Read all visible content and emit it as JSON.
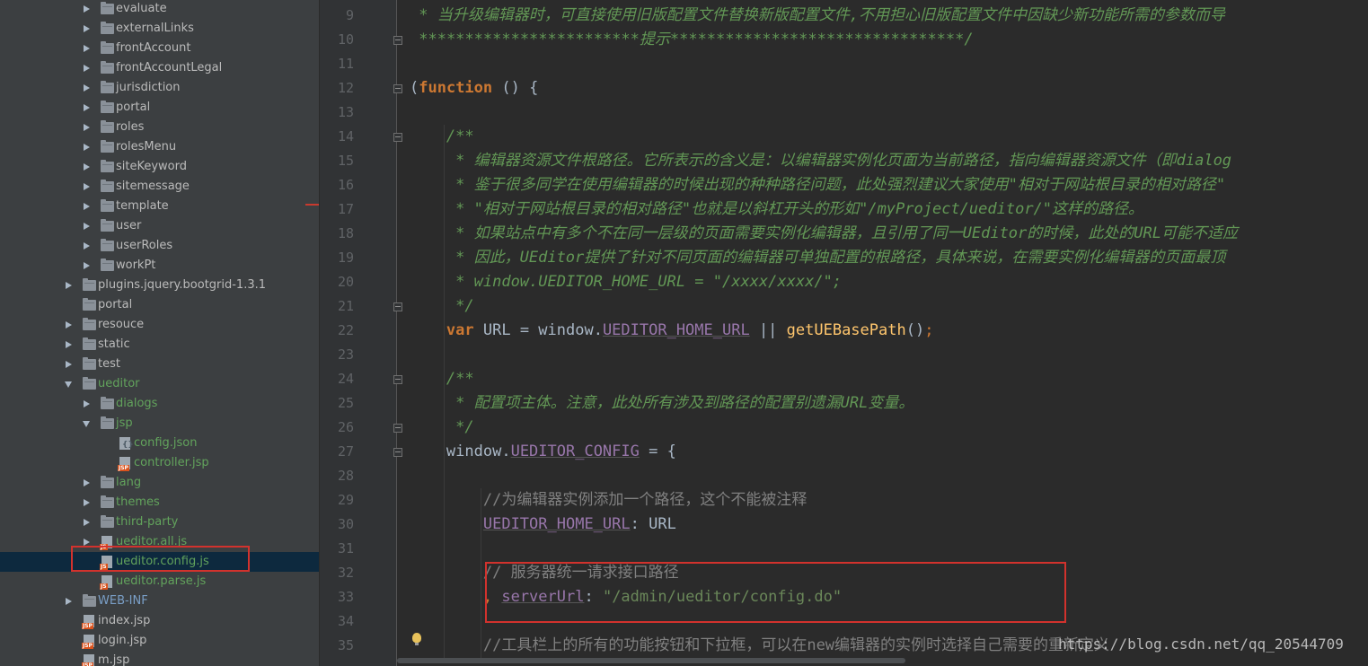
{
  "tree": {
    "nodes": [
      {
        "label": "evaluate",
        "indent": 1,
        "type": "folder",
        "state": "collapsed",
        "color": "default"
      },
      {
        "label": "externalLinks",
        "indent": 1,
        "type": "folder",
        "state": "collapsed",
        "color": "default"
      },
      {
        "label": "frontAccount",
        "indent": 1,
        "type": "folder",
        "state": "collapsed",
        "color": "default"
      },
      {
        "label": "frontAccountLegal",
        "indent": 1,
        "type": "folder",
        "state": "collapsed",
        "color": "default"
      },
      {
        "label": "jurisdiction",
        "indent": 1,
        "type": "folder",
        "state": "collapsed",
        "color": "default"
      },
      {
        "label": "portal",
        "indent": 1,
        "type": "folder",
        "state": "collapsed",
        "color": "default"
      },
      {
        "label": "roles",
        "indent": 1,
        "type": "folder",
        "state": "collapsed",
        "color": "default"
      },
      {
        "label": "rolesMenu",
        "indent": 1,
        "type": "folder",
        "state": "collapsed",
        "color": "default"
      },
      {
        "label": "siteKeyword",
        "indent": 1,
        "type": "folder",
        "state": "collapsed",
        "color": "default"
      },
      {
        "label": "sitemessage",
        "indent": 1,
        "type": "folder",
        "state": "collapsed",
        "color": "default"
      },
      {
        "label": "template",
        "indent": 1,
        "type": "folder",
        "state": "collapsed",
        "color": "default"
      },
      {
        "label": "user",
        "indent": 1,
        "type": "folder",
        "state": "collapsed",
        "color": "default"
      },
      {
        "label": "userRoles",
        "indent": 1,
        "type": "folder",
        "state": "collapsed",
        "color": "default"
      },
      {
        "label": "workPt",
        "indent": 1,
        "type": "folder",
        "state": "collapsed",
        "color": "default"
      },
      {
        "label": "plugins.jquery.bootgrid-1.3.1",
        "indent": 0,
        "type": "folder",
        "state": "collapsed",
        "color": "default"
      },
      {
        "label": "portal",
        "indent": 0,
        "type": "folder",
        "state": "none",
        "color": "default"
      },
      {
        "label": "resouce",
        "indent": 0,
        "type": "folder",
        "state": "collapsed",
        "color": "default"
      },
      {
        "label": "static",
        "indent": 0,
        "type": "folder",
        "state": "collapsed",
        "color": "default"
      },
      {
        "label": "test",
        "indent": 0,
        "type": "folder",
        "state": "collapsed",
        "color": "default"
      },
      {
        "label": "ueditor",
        "indent": 0,
        "type": "folder",
        "state": "expanded",
        "color": "green"
      },
      {
        "label": "dialogs",
        "indent": 1,
        "type": "folder",
        "state": "collapsed",
        "color": "green"
      },
      {
        "label": "jsp",
        "indent": 1,
        "type": "folder",
        "state": "expanded",
        "color": "green"
      },
      {
        "label": "config.json",
        "indent": 2,
        "type": "file",
        "tag": "{}",
        "state": "none",
        "color": "green"
      },
      {
        "label": "controller.jsp",
        "indent": 2,
        "type": "file",
        "tag": "JSP",
        "state": "none",
        "color": "green"
      },
      {
        "label": "lang",
        "indent": 1,
        "type": "folder",
        "state": "collapsed",
        "color": "green"
      },
      {
        "label": "themes",
        "indent": 1,
        "type": "folder",
        "state": "collapsed",
        "color": "green"
      },
      {
        "label": "third-party",
        "indent": 1,
        "type": "folder",
        "state": "collapsed",
        "color": "green"
      },
      {
        "label": "ueditor.all.js",
        "indent": 1,
        "type": "file",
        "tag": "JS",
        "state": "collapsed",
        "color": "green"
      },
      {
        "label": "ueditor.config.js",
        "indent": 1,
        "type": "file",
        "tag": "JS",
        "state": "none",
        "color": "green",
        "selected": true
      },
      {
        "label": "ueditor.parse.js",
        "indent": 1,
        "type": "file",
        "tag": "JS",
        "state": "none",
        "color": "green"
      },
      {
        "label": "WEB-INF",
        "indent": 0,
        "type": "folder",
        "state": "collapsed",
        "color": "blue"
      },
      {
        "label": "index.jsp",
        "indent": 0,
        "type": "file",
        "tag": "JSP",
        "state": "none",
        "color": "default"
      },
      {
        "label": "login.jsp",
        "indent": 0,
        "type": "file",
        "tag": "JSP",
        "state": "none",
        "color": "default"
      },
      {
        "label": "m.jsp",
        "indent": 0,
        "type": "file",
        "tag": "JSP",
        "state": "none",
        "color": "default"
      }
    ]
  },
  "editor": {
    "lines": [
      {
        "n": "9",
        "indent": 0,
        "fold": false,
        "tokens": [
          {
            "t": " * 当升级编辑器时，可直接使用旧版配置文件替换新版配置文件,不用担心旧版配置文件中因缺少新功能所需的参数而导",
            "c": "cm"
          }
        ]
      },
      {
        "n": "10",
        "indent": 0,
        "fold": true,
        "tokens": [
          {
            "t": " ************************提示********************************/",
            "c": "cm"
          }
        ]
      },
      {
        "n": "11",
        "indent": 0,
        "fold": false,
        "tokens": []
      },
      {
        "n": "12",
        "indent": 0,
        "fold": true,
        "tokens": [
          {
            "t": "(",
            "c": "tx"
          },
          {
            "t": "function",
            "c": "kw"
          },
          {
            "t": " () {",
            "c": "tx"
          }
        ]
      },
      {
        "n": "13",
        "indent": 0,
        "fold": false,
        "tokens": []
      },
      {
        "n": "14",
        "indent": 4,
        "fold": true,
        "tokens": [
          {
            "t": "/**",
            "c": "cm"
          }
        ]
      },
      {
        "n": "15",
        "indent": 4,
        "fold": false,
        "tokens": [
          {
            "t": " * 编辑器资源文件根路径。它所表示的含义是：以编辑器实例化页面为当前路径，指向编辑器资源文件（即dialog",
            "c": "cm"
          }
        ]
      },
      {
        "n": "16",
        "indent": 4,
        "fold": false,
        "tokens": [
          {
            "t": " * 鉴于很多同学在使用编辑器的时候出现的种种路径问题，此处强烈建议大家使用\"相对于网站根目录的相对路径\"",
            "c": "cm"
          }
        ]
      },
      {
        "n": "17",
        "indent": 4,
        "fold": false,
        "tokens": [
          {
            "t": " * \"相对于网站根目录的相对路径\"也就是以斜杠开头的形如\"/myProject/ueditor/\"这样的路径。",
            "c": "cm"
          }
        ]
      },
      {
        "n": "18",
        "indent": 4,
        "fold": false,
        "tokens": [
          {
            "t": " * 如果站点中有多个不在同一层级的页面需要实例化编辑器，且引用了同一UEditor的时候，此处的URL可能不适应",
            "c": "cm"
          }
        ]
      },
      {
        "n": "19",
        "indent": 4,
        "fold": false,
        "tokens": [
          {
            "t": " * 因此，UEditor提供了针对不同页面的编辑器可单独配置的根路径，具体来说，在需要实例化编辑器的页面最顶",
            "c": "cm"
          }
        ]
      },
      {
        "n": "20",
        "indent": 4,
        "fold": false,
        "tokens": [
          {
            "t": " * window.UEDITOR_HOME_URL = \"/xxxx/xxxx/\";",
            "c": "cm"
          }
        ]
      },
      {
        "n": "21",
        "indent": 4,
        "fold": true,
        "tokens": [
          {
            "t": " */",
            "c": "cm"
          }
        ]
      },
      {
        "n": "22",
        "indent": 4,
        "fold": false,
        "tokens": [
          {
            "t": "var",
            "c": "kw"
          },
          {
            "t": " URL = window.",
            "c": "tx"
          },
          {
            "t": "UEDITOR_HOME_URL",
            "c": "pp"
          },
          {
            "t": " || ",
            "c": "tx"
          },
          {
            "t": "getUEBasePath",
            "c": "fn"
          },
          {
            "t": "()",
            "c": "tx"
          },
          {
            "t": ";",
            "c": "kwn"
          }
        ]
      },
      {
        "n": "23",
        "indent": 0,
        "fold": false,
        "tokens": []
      },
      {
        "n": "24",
        "indent": 4,
        "fold": true,
        "tokens": [
          {
            "t": "/**",
            "c": "cm"
          }
        ]
      },
      {
        "n": "25",
        "indent": 4,
        "fold": false,
        "tokens": [
          {
            "t": " * 配置项主体。注意，此处所有涉及到路径的配置别遗漏URL变量。",
            "c": "cm"
          }
        ]
      },
      {
        "n": "26",
        "indent": 4,
        "fold": true,
        "tokens": [
          {
            "t": " */",
            "c": "cm"
          }
        ]
      },
      {
        "n": "27",
        "indent": 4,
        "fold": true,
        "tokens": [
          {
            "t": "window.",
            "c": "tx"
          },
          {
            "t": "UEDITOR_CONFIG",
            "c": "pp"
          },
          {
            "t": " = {",
            "c": "tx"
          }
        ]
      },
      {
        "n": "28",
        "indent": 0,
        "fold": false,
        "tokens": []
      },
      {
        "n": "29",
        "indent": 8,
        "fold": false,
        "tokens": [
          {
            "t": "//为编辑器实例添加一个路径，这个不能被注释",
            "c": "lc"
          }
        ]
      },
      {
        "n": "30",
        "indent": 8,
        "fold": false,
        "tokens": [
          {
            "t": "UEDITOR_HOME_URL",
            "c": "pp"
          },
          {
            "t": ": URL",
            "c": "tx"
          }
        ]
      },
      {
        "n": "31",
        "indent": 0,
        "fold": false,
        "tokens": []
      },
      {
        "n": "32",
        "indent": 8,
        "fold": false,
        "tokens": [
          {
            "t": "// 服务器统一请求接口路径",
            "c": "lc"
          }
        ]
      },
      {
        "n": "33",
        "indent": 8,
        "fold": false,
        "tokens": [
          {
            "t": ", ",
            "c": "kwn"
          },
          {
            "t": "serverUrl",
            "c": "pp"
          },
          {
            "t": ": ",
            "c": "tx"
          },
          {
            "t": "\"/admin/ueditor/config.do\"",
            "c": "st"
          }
        ]
      },
      {
        "n": "34",
        "indent": 0,
        "fold": false,
        "tokens": []
      },
      {
        "n": "35",
        "indent": 8,
        "fold": false,
        "tokens": [
          {
            "t": "//工具栏上的所有的功能按钮和下拉框，可以在new编辑器的实例时选择自己需要的重新定义",
            "c": "lc"
          }
        ]
      }
    ]
  },
  "watermark": "https://blog.csdn.net/qq_20544709"
}
